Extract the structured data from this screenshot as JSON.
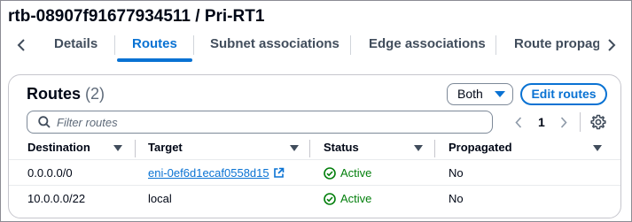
{
  "page": {
    "title": "rtb-08907f91677934511 / Pri-RT1"
  },
  "tabs": [
    {
      "label": "Details",
      "active": false
    },
    {
      "label": "Routes",
      "active": true
    },
    {
      "label": "Subnet associations",
      "active": false
    },
    {
      "label": "Edge associations",
      "active": false
    },
    {
      "label": "Route propagation",
      "active": false
    }
  ],
  "routes": {
    "title": "Routes",
    "count": "(2)",
    "filter_select": "Both",
    "edit_button": "Edit routes",
    "search_placeholder": "Filter routes",
    "current_page": "1",
    "columns": [
      "Destination",
      "Target",
      "Status",
      "Propagated"
    ],
    "rows": [
      {
        "destination": "0.0.0.0/0",
        "target": "eni-0ef6d1ecaf0558d15",
        "target_link": true,
        "status": "Active",
        "propagated": "No"
      },
      {
        "destination": "10.0.0.0/22",
        "target": "local",
        "target_link": false,
        "status": "Active",
        "propagated": "No"
      }
    ]
  },
  "colors": {
    "accent": "#0972d3",
    "success": "#037f0c",
    "text": "#000716"
  },
  "icons": [
    "chevron-left-icon",
    "chevron-right-icon",
    "search-icon",
    "caret-down-icon",
    "gear-icon",
    "sort-caret-icon",
    "external-link-icon",
    "check-circle-icon"
  ]
}
